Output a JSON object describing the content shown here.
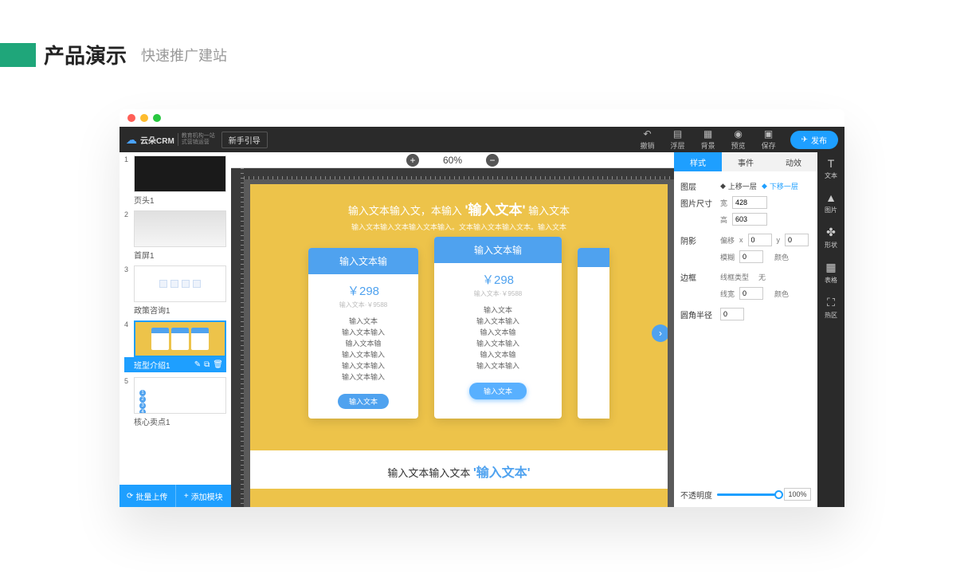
{
  "page": {
    "title": "产品演示",
    "subtitle": "快速推广建站"
  },
  "topbar": {
    "logo": "云朵CRM",
    "logo_sub1": "教育机构一站",
    "logo_sub2": "式营销运营",
    "guide": "新手引导",
    "undo": "撤销",
    "float": "浮层",
    "bg": "背景",
    "preview": "预览",
    "save": "保存",
    "publish": "发布"
  },
  "zoom": {
    "level": "60%"
  },
  "left": {
    "items": [
      {
        "label": "页头1"
      },
      {
        "label": "首屏1"
      },
      {
        "label": "政策咨询1"
      },
      {
        "label": "班型介绍1"
      },
      {
        "label": "核心卖点1"
      }
    ],
    "batch": "批量上传",
    "add": "添加模块"
  },
  "canvas": {
    "hero1": "输入文本输入文，本输入",
    "hero_em": "'输入文本'",
    "hero2": "输入文本",
    "hero_sub": "输入文本输入文本输入文本输入。文本输入文本输入文本。输入文本",
    "card_title": "输入文本输",
    "price": "￥298",
    "strike": "输入文本·￥9588",
    "feat": "输入文本",
    "feat2": "输入文本输入",
    "feat3": "输入文本输",
    "btn": "输入文本",
    "footer1": "输入文本输入文本",
    "footer_em": "'输入文本'"
  },
  "props": {
    "tabs": {
      "style": "样式",
      "event": "事件",
      "anim": "动效"
    },
    "layer": "图层",
    "up": "上移一层",
    "down": "下移一层",
    "size": "图片尺寸",
    "w": "宽",
    "h": "高",
    "wval": "428",
    "hval": "603",
    "shadow": "阴影",
    "offset": "偏移",
    "x": "x",
    "y": "y",
    "xval": "0",
    "yval": "0",
    "blur": "模糊",
    "blurval": "0",
    "color": "颜色",
    "border": "边框",
    "linetype": "线框类型",
    "none": "无",
    "linewidth": "线宽",
    "lwval": "0",
    "radius": "圆角半径",
    "rval": "0",
    "opacity": "不透明度",
    "opval": "100%"
  },
  "tools": {
    "text": "文本",
    "image": "图片",
    "shape": "形状",
    "table": "表格",
    "hot": "热区"
  }
}
